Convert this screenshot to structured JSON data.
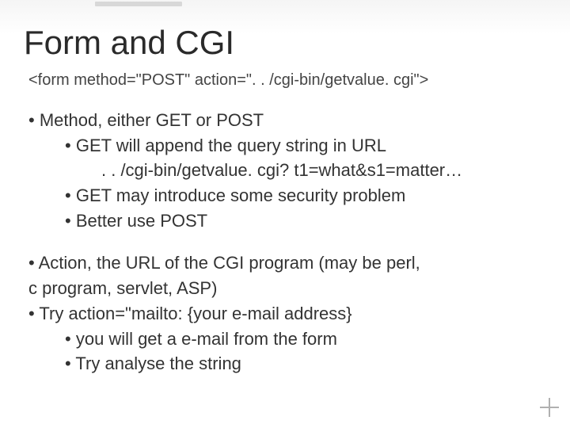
{
  "title": "Form and CGI",
  "code_line": "<form method=\"POST\" action=\". . /cgi-bin/getvalue. cgi\">",
  "block1": {
    "b1": "Method, either GET or POST",
    "b1_1": "GET will append the query string in URL",
    "b1_1_cont": ". . /cgi-bin/getvalue. cgi? t1=what&s1=matter…",
    "b1_2": "GET may introduce some security problem",
    "b1_3": "Better use POST"
  },
  "block2": {
    "b1": "Action, the URL of the CGI program (may be perl,",
    "b1_cont": "c program, servlet, ASP)",
    "b2": "Try action=\"mailto: {your e-mail address}",
    "b2_1": "you will get a e-mail from the form",
    "b2_2": "Try analyse the string"
  }
}
